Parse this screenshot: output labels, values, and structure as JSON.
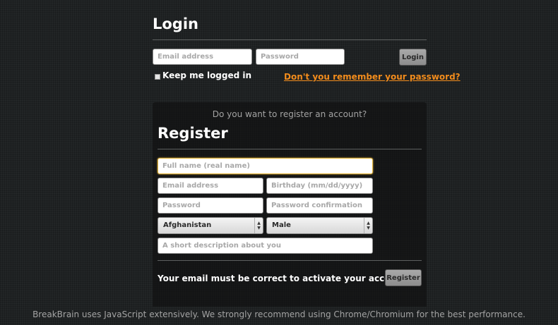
{
  "login": {
    "title": "Login",
    "email_placeholder": "Email address",
    "password_placeholder": "Password",
    "button_label": "Login",
    "keep_logged_in_label": "Keep me logged in",
    "forgot_password_link": "Don't you remember your password?"
  },
  "register": {
    "question": "Do you want to register an account?",
    "title": "Register",
    "fullname_placeholder": "Full name (real name)",
    "email_placeholder": "Email address",
    "birthday_placeholder": "Birthday (mm/dd/yyyy)",
    "password_placeholder": "Password",
    "password_confirm_placeholder": "Password confirmation",
    "country_selected": "Afghanistan",
    "gender_selected": "Male",
    "description_placeholder": "A short description about you",
    "email_note": "Your email must be correct to activate your account",
    "button_label": "Register"
  },
  "footer": {
    "note": "BreakBrain uses JavaScript extensively. We strongly recommend using Chrome/Chromium for the best performance."
  },
  "colors": {
    "background": "#1f2223",
    "link_orange": "#f28c1c",
    "focus_yellow": "#e2b33a",
    "muted_text": "#a3a3a3"
  }
}
